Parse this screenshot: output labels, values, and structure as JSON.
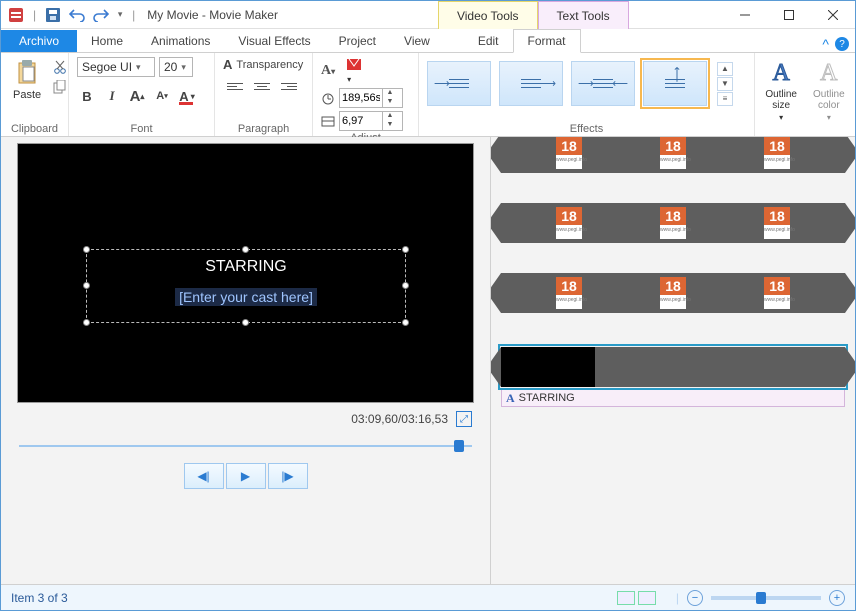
{
  "title": "My Movie - Movie Maker",
  "qat": {
    "save": "save",
    "undo": "undo",
    "redo": "redo"
  },
  "context_tabs": {
    "video": "Video Tools",
    "text": "Text Tools"
  },
  "window_controls": {
    "min": "minimize",
    "max": "maximize",
    "close": "close"
  },
  "menu": {
    "file": "Archivo",
    "home": "Home",
    "animations": "Animations",
    "visual_effects": "Visual Effects",
    "project": "Project",
    "view": "View",
    "edit": "Edit",
    "format": "Format"
  },
  "ribbon": {
    "clipboard": {
      "label": "Clipboard",
      "paste": "Paste"
    },
    "font": {
      "label": "Font",
      "family": "Segoe UI",
      "size": "20",
      "transparency": "Transparency"
    },
    "paragraph": {
      "label": "Paragraph"
    },
    "adjust": {
      "label": "Adjust",
      "time": "189,56s",
      "speed": "6,97"
    },
    "effects": {
      "label": "Effects"
    },
    "outline_size": "Outline size",
    "outline_color": "Outline color"
  },
  "preview": {
    "title_text": "STARRING",
    "placeholder_text": "[Enter your cast here]",
    "timecode": "03:09,60/03:16,53"
  },
  "timeline": {
    "badge_num": "18",
    "badge_sub": "www.pegi.info",
    "caption_label": "STARRING"
  },
  "status": {
    "item_text": "Item 3 of 3"
  }
}
